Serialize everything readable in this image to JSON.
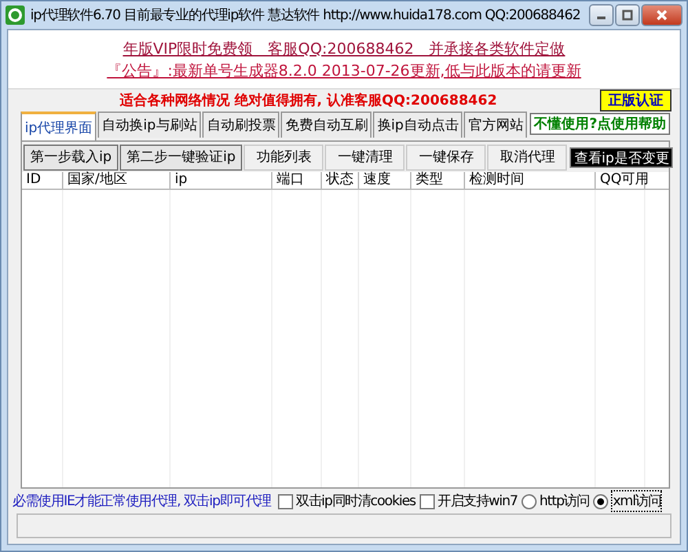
{
  "window": {
    "title": "ip代理软件6.70 目前最专业的代理ip软件 慧达软件 http://www.huida178.com QQ:200688462"
  },
  "banner": {
    "links": [
      "年版VIP限时免费领　客服QQ:200688462　并承接各类软件定做",
      "『公告』:最新单号生成器8.2.0 2013-07-26更新,低与此版本的请更新"
    ]
  },
  "slogan": "适合各种网络情况  绝对值得拥有, 认准客服QQ:200688462",
  "badge": "正版认证",
  "help_link": "不懂使用?点使用帮助",
  "tabs": [
    {
      "label": "ip代理界面",
      "selected": true
    },
    {
      "label": "自动换ip与刷站",
      "selected": false
    },
    {
      "label": "自动刷投票",
      "selected": false
    },
    {
      "label": "免费自动互刷",
      "selected": false
    },
    {
      "label": "换ip自动点击",
      "selected": false
    },
    {
      "label": "官方网站",
      "selected": false
    }
  ],
  "toolbar": {
    "buttons": [
      {
        "label": "第一步载入ip",
        "kind": "raised"
      },
      {
        "label": "第二步一键验证ip",
        "kind": "raised"
      },
      {
        "label": "功能列表",
        "kind": "flat"
      },
      {
        "label": "一键清理",
        "kind": "flat"
      },
      {
        "label": "一键保存",
        "kind": "flat"
      },
      {
        "label": "取消代理",
        "kind": "flat"
      }
    ],
    "check_button": "查看ip是否变更"
  },
  "table": {
    "columns": [
      "ID",
      "国家/地区",
      "ip",
      "端口",
      "状态",
      "速度",
      "类型",
      "检测时间",
      "QQ可用"
    ]
  },
  "footer": {
    "note": "必需使用IE才能正常使用代理, 双击ip即可代理",
    "options": [
      {
        "kind": "checkbox",
        "label": "双击ip同时清cookies",
        "selected": false
      },
      {
        "kind": "checkbox",
        "label": "开启支持win7",
        "selected": false
      },
      {
        "kind": "radio",
        "label": "http访问",
        "selected": false
      },
      {
        "kind": "radio",
        "label": "xml访问",
        "selected": true
      }
    ]
  }
}
